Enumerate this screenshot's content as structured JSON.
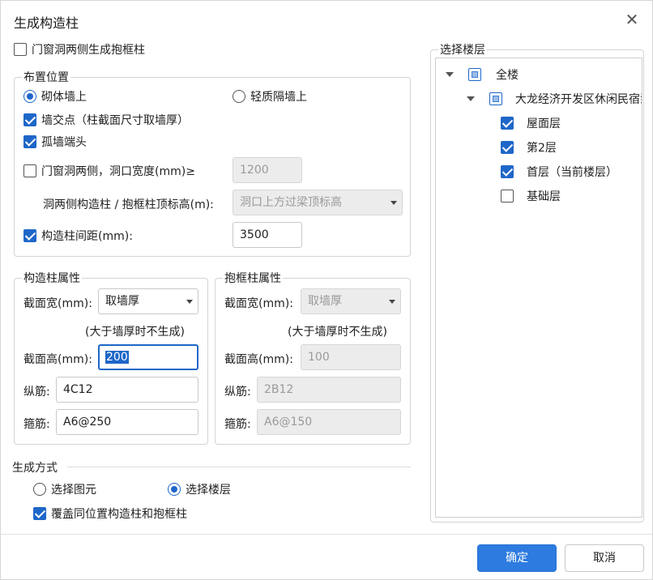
{
  "dialog": {
    "title": "生成构造柱",
    "close_icon": "close-icon"
  },
  "top_option": {
    "label": "门窗洞两侧生成抱框柱",
    "checked": false
  },
  "placement": {
    "title": "布置位置",
    "radio_brick": "砌体墙上",
    "radio_light": "轻质隔墙上",
    "wall_junction": "墙交点（柱截面尺寸取墙厚）",
    "isolated_end": "孤墙端头",
    "opening_sides": "门窗洞两侧，洞口宽度(mm)≥",
    "opening_width_value": "1200",
    "top_elev_label": "洞两侧构造柱 / 抱框柱顶标高(m):",
    "top_elev_value": "洞口上方过梁顶标高",
    "spacing_label": "构造柱间距(mm):",
    "spacing_value": "3500"
  },
  "gz_props": {
    "title": "构造柱属性",
    "width_label": "截面宽(mm):",
    "width_value": "取墙厚",
    "note": "(大于墙厚时不生成)",
    "height_label": "截面高(mm):",
    "height_value": "200",
    "long_bar_label": "纵筋:",
    "long_bar_value": "4C12",
    "stirrup_label": "箍筋:",
    "stirrup_value": "A6@250"
  },
  "bk_props": {
    "title": "抱框柱属性",
    "width_label": "截面宽(mm):",
    "width_value": "取墙厚",
    "note": "(大于墙厚时不生成)",
    "height_label": "截面高(mm):",
    "height_value": "100",
    "long_bar_label": "纵筋:",
    "long_bar_value": "2B12",
    "stirrup_label": "箍筋:",
    "stirrup_value": "A6@150"
  },
  "gen_mode": {
    "title": "生成方式",
    "radio_elements": "选择图元",
    "radio_floors": "选择楼层",
    "overwrite": "覆盖同位置构造柱和抱框柱"
  },
  "floors": {
    "title": "选择楼层",
    "all": "全楼",
    "project": "大龙经济开发区休闲民宿泵",
    "items": [
      {
        "label": "屋面层",
        "checked": true
      },
      {
        "label": "第2层",
        "checked": true
      },
      {
        "label": "首层（当前楼层）",
        "checked": true
      },
      {
        "label": "基础层",
        "checked": false
      }
    ]
  },
  "footer": {
    "ok": "确定",
    "cancel": "取消"
  },
  "colors": {
    "accent": "#1e67c8",
    "primary_button": "#2d7be0"
  }
}
